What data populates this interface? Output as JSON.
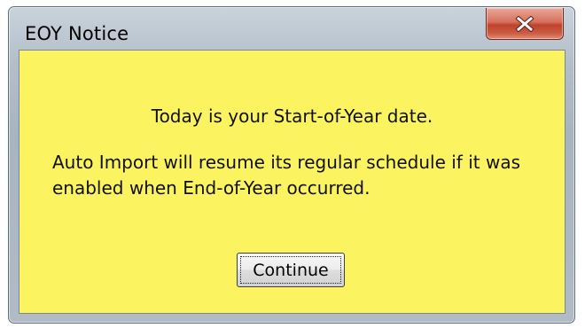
{
  "window": {
    "title": "EOY Notice",
    "close_icon": "close-x-icon"
  },
  "message": {
    "line1": "Today is your Start-of-Year date.",
    "line2": "Auto Import will resume its regular schedule if it was enabled when End-of-Year occurred."
  },
  "buttons": {
    "continue_label": "Continue"
  },
  "colors": {
    "client_background": "#fbf35f",
    "close_button": "#c0432c"
  }
}
